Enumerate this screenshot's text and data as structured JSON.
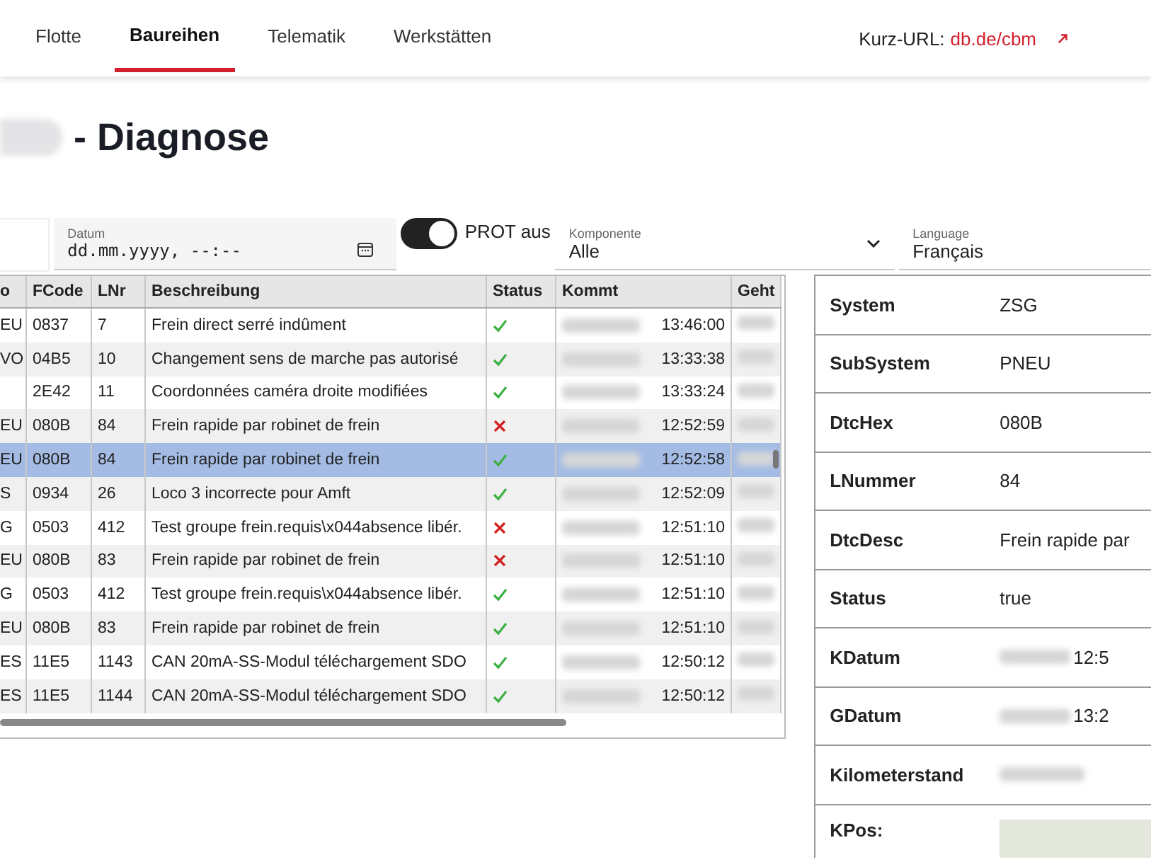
{
  "nav": {
    "tabs": [
      {
        "label": "Flotte",
        "selected": false
      },
      {
        "label": "Baureihen",
        "selected": true
      },
      {
        "label": "Telematik",
        "selected": false
      },
      {
        "label": "Werkstätten",
        "selected": false
      }
    ],
    "short_url": {
      "label": "Kurz-URL:",
      "link": "db.de/cbm"
    }
  },
  "title": "- Diagnose",
  "filters": {
    "date": {
      "label": "Datum",
      "placeholder": "dd.mm.yyyy, --:--"
    },
    "prot_toggle": {
      "label": "PROT aus",
      "on": true
    },
    "component": {
      "label": "Komponente",
      "value": "Alle"
    },
    "language": {
      "label": "Language",
      "value": "Français"
    }
  },
  "table": {
    "columns": [
      "o",
      "FCode",
      "LNr",
      "Beschreibung",
      "Status",
      "Kommt",
      "Geht"
    ],
    "rows": [
      {
        "column_1": "EU",
        "fcode": "0837",
        "lnr": "7",
        "description": "Frein direct serré indûment",
        "status_ok": true,
        "kommt": "13:46:00",
        "selected": false
      },
      {
        "column_1": "VO",
        "fcode": "04B5",
        "lnr": "10",
        "description": "Changement sens de marche pas autorisé",
        "status_ok": true,
        "kommt": "13:33:38",
        "selected": false
      },
      {
        "column_1": "",
        "fcode": "2E42",
        "lnr": "11",
        "description": "Coordonnées caméra droite modifiées",
        "status_ok": true,
        "kommt": "13:33:24",
        "selected": false
      },
      {
        "column_1": "EU",
        "fcode": "080B",
        "lnr": "84",
        "description": "Frein rapide par robinet de frein",
        "status_ok": false,
        "kommt": "12:52:59",
        "selected": false
      },
      {
        "column_1": "EU",
        "fcode": "080B",
        "lnr": "84",
        "description": "Frein rapide par robinet de frein",
        "status_ok": true,
        "kommt": "12:52:58",
        "selected": true
      },
      {
        "column_1": "S",
        "fcode": "0934",
        "lnr": "26",
        "description": "Loco 3 incorrecte pour Amft",
        "status_ok": true,
        "kommt": "12:52:09",
        "selected": false
      },
      {
        "column_1": "G",
        "fcode": "0503",
        "lnr": "412",
        "description": "Test groupe frein.requis\\x044absence libér.",
        "status_ok": false,
        "kommt": "12:51:10",
        "selected": false
      },
      {
        "column_1": "EU",
        "fcode": "080B",
        "lnr": "83",
        "description": "Frein rapide par robinet de frein",
        "status_ok": false,
        "kommt": "12:51:10",
        "selected": false
      },
      {
        "column_1": "G",
        "fcode": "0503",
        "lnr": "412",
        "description": "Test groupe frein.requis\\x044absence libér.",
        "status_ok": true,
        "kommt": "12:51:10",
        "selected": false
      },
      {
        "column_1": "EU",
        "fcode": "080B",
        "lnr": "83",
        "description": "Frein rapide par robinet de frein",
        "status_ok": true,
        "kommt": "12:51:10",
        "selected": false
      },
      {
        "column_1": "ES",
        "fcode": "11E5",
        "lnr": "1143",
        "description": "CAN 20mA-SS-Modul téléchargement SDO",
        "status_ok": true,
        "kommt": "12:50:12",
        "selected": false
      },
      {
        "column_1": "ES",
        "fcode": "11E5",
        "lnr": "1144",
        "description": "CAN 20mA-SS-Modul téléchargement SDO",
        "status_ok": true,
        "kommt": "12:50:12",
        "selected": false
      }
    ]
  },
  "details": [
    {
      "label": "System",
      "value": "ZSG",
      "kind": "text"
    },
    {
      "label": "SubSystem",
      "value": "PNEU",
      "kind": "text"
    },
    {
      "label": "DtcHex",
      "value": "080B",
      "kind": "text"
    },
    {
      "label": "LNummer",
      "value": "84",
      "kind": "text"
    },
    {
      "label": "DtcDesc",
      "value": "Frein rapide par",
      "kind": "text"
    },
    {
      "label": "Status",
      "value": "true",
      "kind": "text"
    },
    {
      "label": "KDatum",
      "value": "12:5",
      "kind": "date"
    },
    {
      "label": "GDatum",
      "value": "13:2",
      "kind": "date"
    },
    {
      "label": "Kilometerstand",
      "kind": "redacted"
    },
    {
      "label": "KPos:",
      "kind": "map"
    }
  ]
}
